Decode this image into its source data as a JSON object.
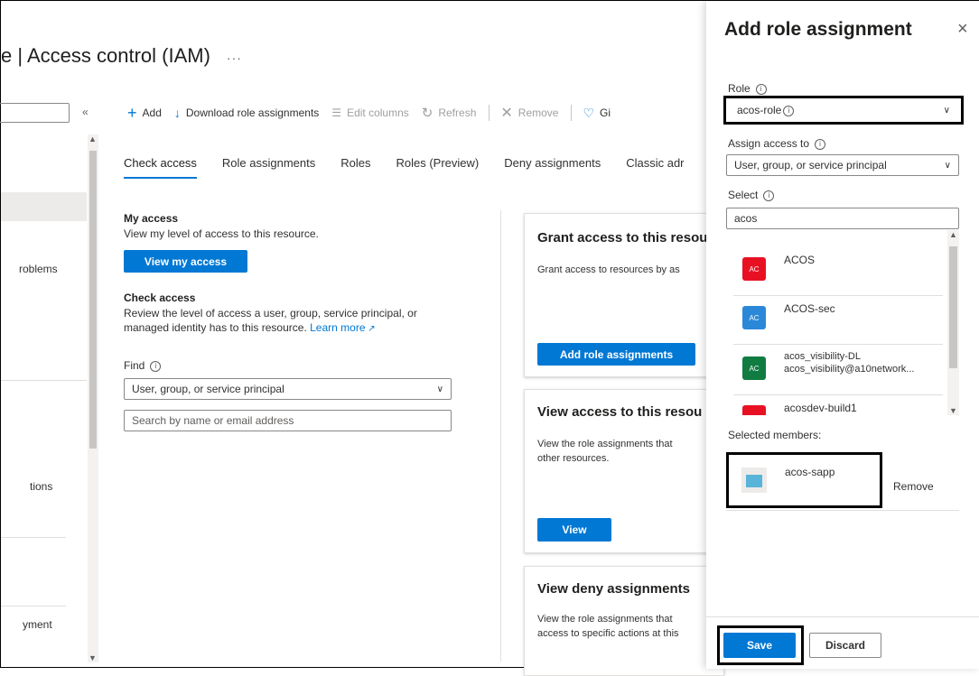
{
  "page": {
    "title": "e | Access control (IAM)",
    "more": "···"
  },
  "left_nav": {
    "collapse": "«",
    "items": [
      {
        "label": "roblems"
      },
      {
        "label": "tions"
      },
      {
        "label": "yment"
      }
    ]
  },
  "toolbar": {
    "add": "Add",
    "download": "Download role assignments",
    "edit_columns": "Edit columns",
    "refresh": "Refresh",
    "remove": "Remove",
    "feedback": "Gi"
  },
  "tabs": [
    "Check access",
    "Role assignments",
    "Roles",
    "Roles (Preview)",
    "Deny assignments",
    "Classic adr"
  ],
  "my_access": {
    "heading": "My access",
    "desc": "View my level of access to this resource.",
    "button": "View my access"
  },
  "check_access": {
    "heading": "Check access",
    "desc1": "Review the level of access a user, group, service principal, or",
    "desc2": "managed identity has to this resource.",
    "learn_more": "Learn more",
    "find_label": "Find",
    "find_value": "User, group, or service principal",
    "search_placeholder": "Search by name or email address"
  },
  "cards": {
    "grant": {
      "title": "Grant access to this resou",
      "desc": "Grant access to resources by as",
      "button": "Add role assignments"
    },
    "view": {
      "title": "View access to this resou",
      "desc1": "View the role assignments that",
      "desc2": "other resources.",
      "button": "View"
    },
    "deny": {
      "title": "View deny assignments",
      "desc1": "View the role assignments that",
      "desc2": "access to specific actions at this"
    }
  },
  "panel": {
    "title": "Add role assignment",
    "close": "×",
    "role_label": "Role",
    "role_value": "acos-role",
    "assign_label": "Assign access to",
    "assign_value": "User, group, or service principal",
    "select_label": "Select",
    "select_value": "acos",
    "results": [
      {
        "initials": "AC",
        "name": "ACOS",
        "email": "",
        "color": "#e81123"
      },
      {
        "initials": "AC",
        "name": "ACOS-sec",
        "email": "",
        "color": "#2b88d8"
      },
      {
        "initials": "AC",
        "name": "acos_visibility-DL",
        "email": "acos_visibility@a10network...",
        "color": "#107c41"
      },
      {
        "initials": "",
        "name": "acosdev-build1",
        "email": "",
        "color": "#e81123"
      }
    ],
    "selected_label": "Selected members:",
    "selected_member": "acos-sapp",
    "remove": "Remove",
    "save": "Save",
    "discard": "Discard"
  },
  "colors": {
    "accent": "#0078d4",
    "highlight_border": "#000000"
  }
}
